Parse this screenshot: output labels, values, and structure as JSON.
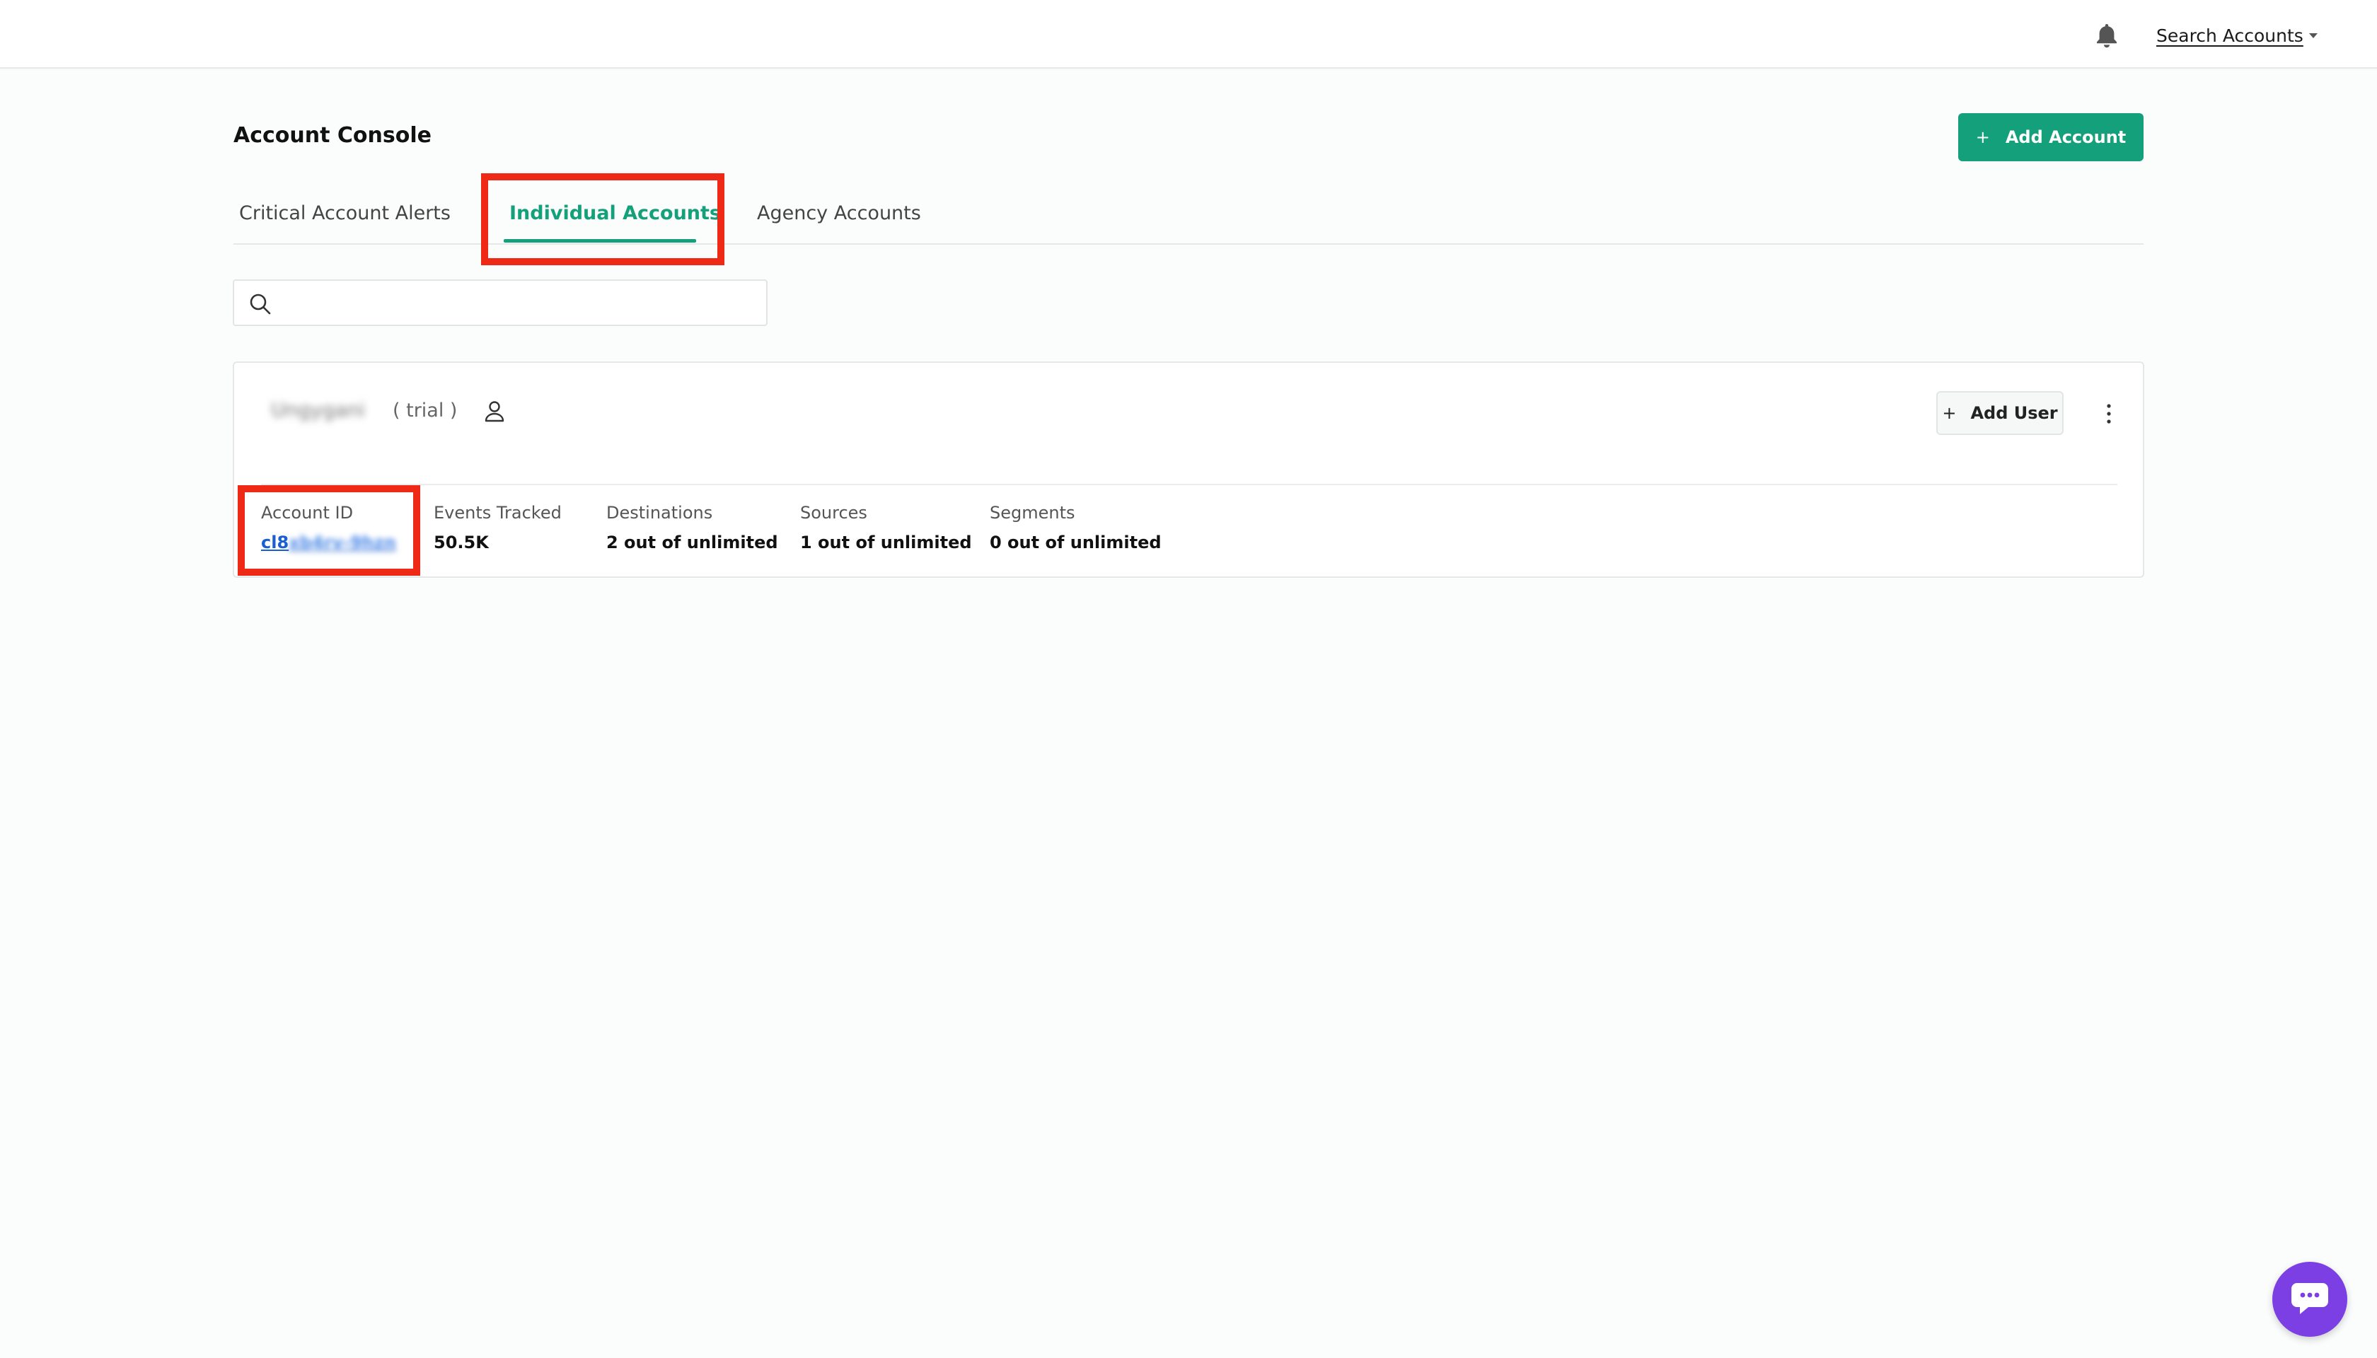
{
  "header": {
    "search_accounts_label": "Search Accounts",
    "icons": {
      "notifications": "bell-icon",
      "dropdown": "caret-down-icon"
    }
  },
  "page": {
    "title": "Account Console",
    "add_account_label": "Add Account",
    "add_account_icon": "plus-icon"
  },
  "tabs": [
    {
      "label": "Critical Account Alerts",
      "active": false
    },
    {
      "label": "Individual Accounts",
      "active": true
    },
    {
      "label": "Agency Accounts",
      "active": false
    }
  ],
  "search": {
    "placeholder": "",
    "value": "",
    "icon": "search-icon"
  },
  "account": {
    "name": "Ungygani",
    "status": "( trial )",
    "user_icon": "user-icon",
    "add_user_label": "Add User",
    "menu_icon": "kebab-menu-icon",
    "stats": {
      "account_id_label": "Account ID",
      "account_id_prefix": "cl8",
      "account_id_rest": "xb4rv-9hzn",
      "events_tracked_label": "Events Tracked",
      "events_tracked_value": "50.5K",
      "destinations_label": "Destinations",
      "destinations_value": "2 out of unlimited",
      "sources_label": "Sources",
      "sources_value": "1 out of unlimited",
      "segments_label": "Segments",
      "segments_value": "0 out of unlimited"
    }
  },
  "colors": {
    "accent": "#14a07a",
    "highlight": "#ee2a16",
    "chat": "#7b3fe4",
    "link": "#1a5fd1"
  },
  "chat": {
    "icon": "chat-bubble-icon"
  }
}
